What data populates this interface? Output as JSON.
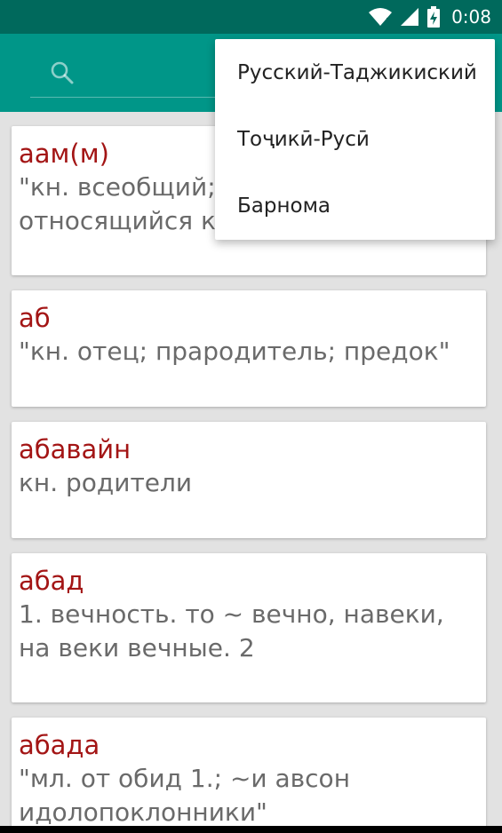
{
  "status_bar": {
    "time": "0:08",
    "icons": [
      "wifi-icon",
      "signal-icon",
      "battery-charging-icon"
    ]
  },
  "app_bar": {
    "search_icon": "search-icon"
  },
  "menu": {
    "items": [
      {
        "label": "Русский-Таджикиский"
      },
      {
        "label": "Тоҷикӣ-Русӣ"
      },
      {
        "label": "Барнома"
      }
    ]
  },
  "entries": [
    {
      "word": "аам(м)",
      "lines": [
        "\"кн. всеобщий;",
        "относящийся к"
      ]
    },
    {
      "word": "аб",
      "lines": [
        "\"кн. отец; прародитель; предок\""
      ]
    },
    {
      "word": "абавайн",
      "lines": [
        "кн. родители"
      ]
    },
    {
      "word": "абад",
      "lines": [
        "1. вечность. то ~ вечно, навеки,",
        "на веки вечные. 2"
      ]
    },
    {
      "word": "абада",
      "lines": [
        "\"мл. от обид 1.; ~и авсон",
        "идолопоклонники\""
      ]
    }
  ],
  "colors": {
    "status_bar": "#00695c",
    "app_bar": "#009688",
    "word": "#a31515",
    "definition": "#6a6a6a",
    "background": "#e2e2e2"
  }
}
